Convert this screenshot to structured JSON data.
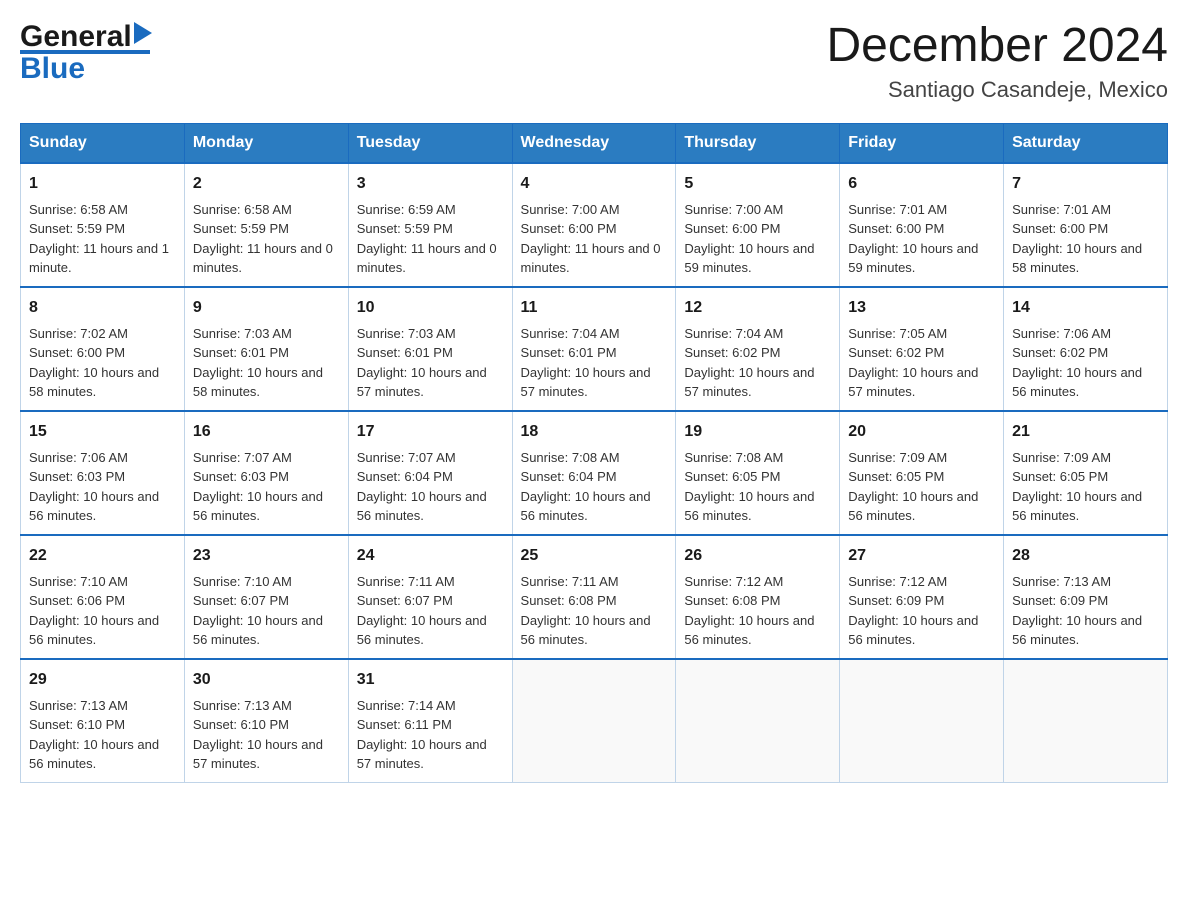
{
  "header": {
    "logo": {
      "general": "General",
      "triangle": "▶",
      "blue": "Blue"
    },
    "title": "December 2024",
    "subtitle": "Santiago Casandeje, Mexico"
  },
  "days": [
    "Sunday",
    "Monday",
    "Tuesday",
    "Wednesday",
    "Thursday",
    "Friday",
    "Saturday"
  ],
  "weeks": [
    [
      {
        "day": "1",
        "sunrise": "Sunrise: 6:58 AM",
        "sunset": "Sunset: 5:59 PM",
        "daylight": "Daylight: 11 hours and 1 minute."
      },
      {
        "day": "2",
        "sunrise": "Sunrise: 6:58 AM",
        "sunset": "Sunset: 5:59 PM",
        "daylight": "Daylight: 11 hours and 0 minutes."
      },
      {
        "day": "3",
        "sunrise": "Sunrise: 6:59 AM",
        "sunset": "Sunset: 5:59 PM",
        "daylight": "Daylight: 11 hours and 0 minutes."
      },
      {
        "day": "4",
        "sunrise": "Sunrise: 7:00 AM",
        "sunset": "Sunset: 6:00 PM",
        "daylight": "Daylight: 11 hours and 0 minutes."
      },
      {
        "day": "5",
        "sunrise": "Sunrise: 7:00 AM",
        "sunset": "Sunset: 6:00 PM",
        "daylight": "Daylight: 10 hours and 59 minutes."
      },
      {
        "day": "6",
        "sunrise": "Sunrise: 7:01 AM",
        "sunset": "Sunset: 6:00 PM",
        "daylight": "Daylight: 10 hours and 59 minutes."
      },
      {
        "day": "7",
        "sunrise": "Sunrise: 7:01 AM",
        "sunset": "Sunset: 6:00 PM",
        "daylight": "Daylight: 10 hours and 58 minutes."
      }
    ],
    [
      {
        "day": "8",
        "sunrise": "Sunrise: 7:02 AM",
        "sunset": "Sunset: 6:00 PM",
        "daylight": "Daylight: 10 hours and 58 minutes."
      },
      {
        "day": "9",
        "sunrise": "Sunrise: 7:03 AM",
        "sunset": "Sunset: 6:01 PM",
        "daylight": "Daylight: 10 hours and 58 minutes."
      },
      {
        "day": "10",
        "sunrise": "Sunrise: 7:03 AM",
        "sunset": "Sunset: 6:01 PM",
        "daylight": "Daylight: 10 hours and 57 minutes."
      },
      {
        "day": "11",
        "sunrise": "Sunrise: 7:04 AM",
        "sunset": "Sunset: 6:01 PM",
        "daylight": "Daylight: 10 hours and 57 minutes."
      },
      {
        "day": "12",
        "sunrise": "Sunrise: 7:04 AM",
        "sunset": "Sunset: 6:02 PM",
        "daylight": "Daylight: 10 hours and 57 minutes."
      },
      {
        "day": "13",
        "sunrise": "Sunrise: 7:05 AM",
        "sunset": "Sunset: 6:02 PM",
        "daylight": "Daylight: 10 hours and 57 minutes."
      },
      {
        "day": "14",
        "sunrise": "Sunrise: 7:06 AM",
        "sunset": "Sunset: 6:02 PM",
        "daylight": "Daylight: 10 hours and 56 minutes."
      }
    ],
    [
      {
        "day": "15",
        "sunrise": "Sunrise: 7:06 AM",
        "sunset": "Sunset: 6:03 PM",
        "daylight": "Daylight: 10 hours and 56 minutes."
      },
      {
        "day": "16",
        "sunrise": "Sunrise: 7:07 AM",
        "sunset": "Sunset: 6:03 PM",
        "daylight": "Daylight: 10 hours and 56 minutes."
      },
      {
        "day": "17",
        "sunrise": "Sunrise: 7:07 AM",
        "sunset": "Sunset: 6:04 PM",
        "daylight": "Daylight: 10 hours and 56 minutes."
      },
      {
        "day": "18",
        "sunrise": "Sunrise: 7:08 AM",
        "sunset": "Sunset: 6:04 PM",
        "daylight": "Daylight: 10 hours and 56 minutes."
      },
      {
        "day": "19",
        "sunrise": "Sunrise: 7:08 AM",
        "sunset": "Sunset: 6:05 PM",
        "daylight": "Daylight: 10 hours and 56 minutes."
      },
      {
        "day": "20",
        "sunrise": "Sunrise: 7:09 AM",
        "sunset": "Sunset: 6:05 PM",
        "daylight": "Daylight: 10 hours and 56 minutes."
      },
      {
        "day": "21",
        "sunrise": "Sunrise: 7:09 AM",
        "sunset": "Sunset: 6:05 PM",
        "daylight": "Daylight: 10 hours and 56 minutes."
      }
    ],
    [
      {
        "day": "22",
        "sunrise": "Sunrise: 7:10 AM",
        "sunset": "Sunset: 6:06 PM",
        "daylight": "Daylight: 10 hours and 56 minutes."
      },
      {
        "day": "23",
        "sunrise": "Sunrise: 7:10 AM",
        "sunset": "Sunset: 6:07 PM",
        "daylight": "Daylight: 10 hours and 56 minutes."
      },
      {
        "day": "24",
        "sunrise": "Sunrise: 7:11 AM",
        "sunset": "Sunset: 6:07 PM",
        "daylight": "Daylight: 10 hours and 56 minutes."
      },
      {
        "day": "25",
        "sunrise": "Sunrise: 7:11 AM",
        "sunset": "Sunset: 6:08 PM",
        "daylight": "Daylight: 10 hours and 56 minutes."
      },
      {
        "day": "26",
        "sunrise": "Sunrise: 7:12 AM",
        "sunset": "Sunset: 6:08 PM",
        "daylight": "Daylight: 10 hours and 56 minutes."
      },
      {
        "day": "27",
        "sunrise": "Sunrise: 7:12 AM",
        "sunset": "Sunset: 6:09 PM",
        "daylight": "Daylight: 10 hours and 56 minutes."
      },
      {
        "day": "28",
        "sunrise": "Sunrise: 7:13 AM",
        "sunset": "Sunset: 6:09 PM",
        "daylight": "Daylight: 10 hours and 56 minutes."
      }
    ],
    [
      {
        "day": "29",
        "sunrise": "Sunrise: 7:13 AM",
        "sunset": "Sunset: 6:10 PM",
        "daylight": "Daylight: 10 hours and 56 minutes."
      },
      {
        "day": "30",
        "sunrise": "Sunrise: 7:13 AM",
        "sunset": "Sunset: 6:10 PM",
        "daylight": "Daylight: 10 hours and 57 minutes."
      },
      {
        "day": "31",
        "sunrise": "Sunrise: 7:14 AM",
        "sunset": "Sunset: 6:11 PM",
        "daylight": "Daylight: 10 hours and 57 minutes."
      },
      null,
      null,
      null,
      null
    ]
  ]
}
